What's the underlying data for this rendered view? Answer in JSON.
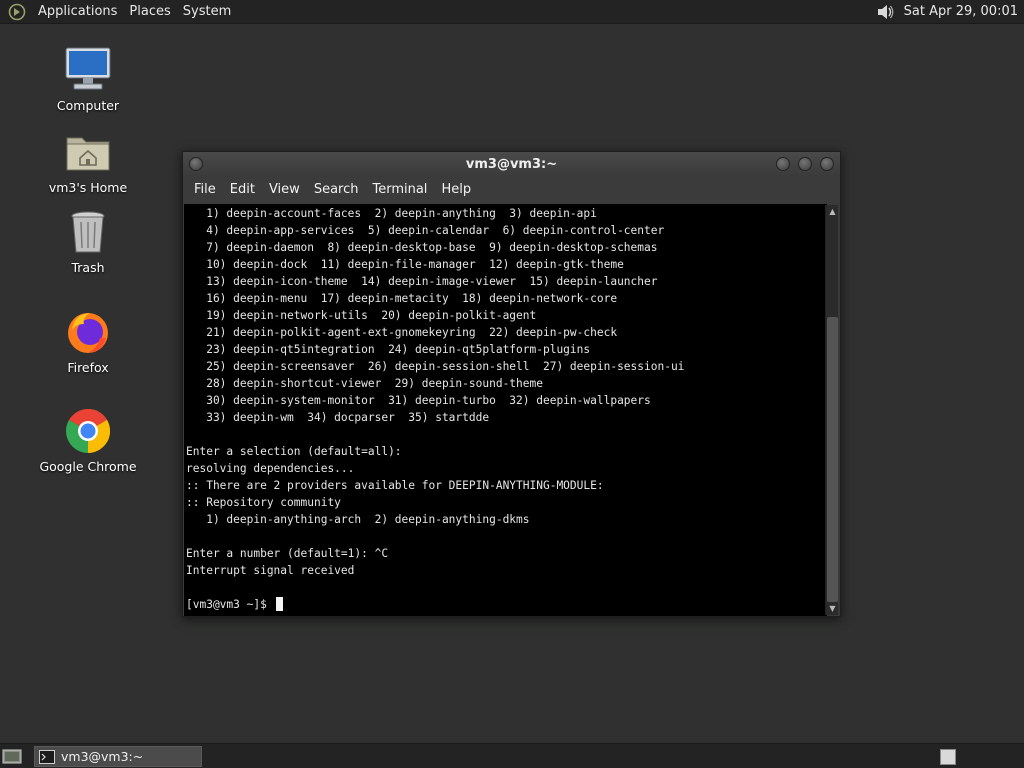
{
  "top_panel": {
    "menus": [
      "Applications",
      "Places",
      "System"
    ],
    "clock": "Sat Apr 29, 00:01",
    "volume_icon": "speaker-icon"
  },
  "desktop_icons": [
    {
      "name": "computer",
      "label": "Computer",
      "icon": "computer-icon"
    },
    {
      "name": "home",
      "label": "vm3's Home",
      "icon": "home-folder-icon"
    },
    {
      "name": "trash",
      "label": "Trash",
      "icon": "trash-icon"
    },
    {
      "name": "firefox",
      "label": "Firefox",
      "icon": "firefox-icon"
    },
    {
      "name": "chrome",
      "label": "Google Chrome",
      "icon": "chrome-icon"
    }
  ],
  "terminal": {
    "title": "vm3@vm3:~",
    "menu": [
      "File",
      "Edit",
      "View",
      "Search",
      "Terminal",
      "Help"
    ],
    "lines": [
      "   1) deepin-account-faces  2) deepin-anything  3) deepin-api",
      "   4) deepin-app-services  5) deepin-calendar  6) deepin-control-center",
      "   7) deepin-daemon  8) deepin-desktop-base  9) deepin-desktop-schemas",
      "   10) deepin-dock  11) deepin-file-manager  12) deepin-gtk-theme",
      "   13) deepin-icon-theme  14) deepin-image-viewer  15) deepin-launcher",
      "   16) deepin-menu  17) deepin-metacity  18) deepin-network-core",
      "   19) deepin-network-utils  20) deepin-polkit-agent",
      "   21) deepin-polkit-agent-ext-gnomekeyring  22) deepin-pw-check",
      "   23) deepin-qt5integration  24) deepin-qt5platform-plugins",
      "   25) deepin-screensaver  26) deepin-session-shell  27) deepin-session-ui",
      "   28) deepin-shortcut-viewer  29) deepin-sound-theme",
      "   30) deepin-system-monitor  31) deepin-turbo  32) deepin-wallpapers",
      "   33) deepin-wm  34) docparser  35) startdde",
      "",
      "Enter a selection (default=all):",
      "resolving dependencies...",
      ":: There are 2 providers available for DEEPIN-ANYTHING-MODULE:",
      ":: Repository community",
      "   1) deepin-anything-arch  2) deepin-anything-dkms",
      "",
      "Enter a number (default=1): ^C",
      "Interrupt signal received",
      ""
    ],
    "prompt": "[vm3@vm3 ~]$ "
  },
  "bottom_panel": {
    "task_label": "vm3@vm3:~"
  },
  "colors": {
    "desktop": "#2f302f",
    "panel": "#232323",
    "terminal_bg": "#000000",
    "terminal_fg": "#e6e6e6"
  }
}
